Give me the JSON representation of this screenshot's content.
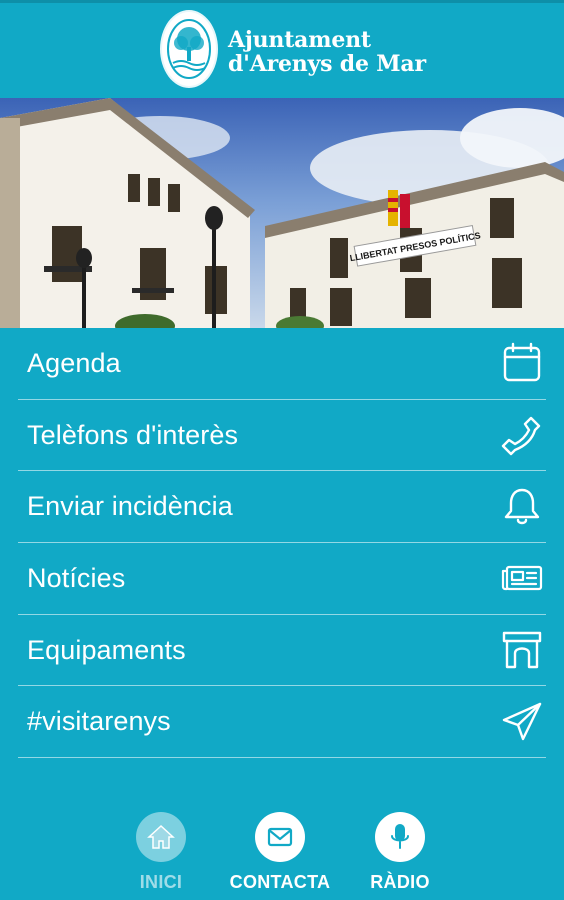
{
  "header": {
    "logo_line1": "Ajuntament",
    "logo_line2": "d'Arenys de Mar",
    "logo_icon": "tree-seal-icon"
  },
  "hero": {
    "banner_text": "LLIBERTAT PRESOS POLÍTICS"
  },
  "menu": {
    "items": [
      {
        "label": "Agenda",
        "icon": "calendar-icon"
      },
      {
        "label": "Telèfons d'interès",
        "icon": "phone-icon"
      },
      {
        "label": "Enviar incidència",
        "icon": "bell-icon"
      },
      {
        "label": "Notícies",
        "icon": "newspaper-icon"
      },
      {
        "label": "Equipaments",
        "icon": "arch-icon"
      },
      {
        "label": "#visitarenys",
        "icon": "paper-plane-icon"
      }
    ]
  },
  "bottom_nav": {
    "items": [
      {
        "label": "INICI",
        "icon": "home-icon",
        "active": true
      },
      {
        "label": "CONTACTA",
        "icon": "envelope-icon",
        "active": false
      },
      {
        "label": "RÀDIO",
        "icon": "microphone-icon",
        "active": false
      }
    ]
  },
  "colors": {
    "background": "#11a9c6",
    "text": "#ffffff"
  }
}
